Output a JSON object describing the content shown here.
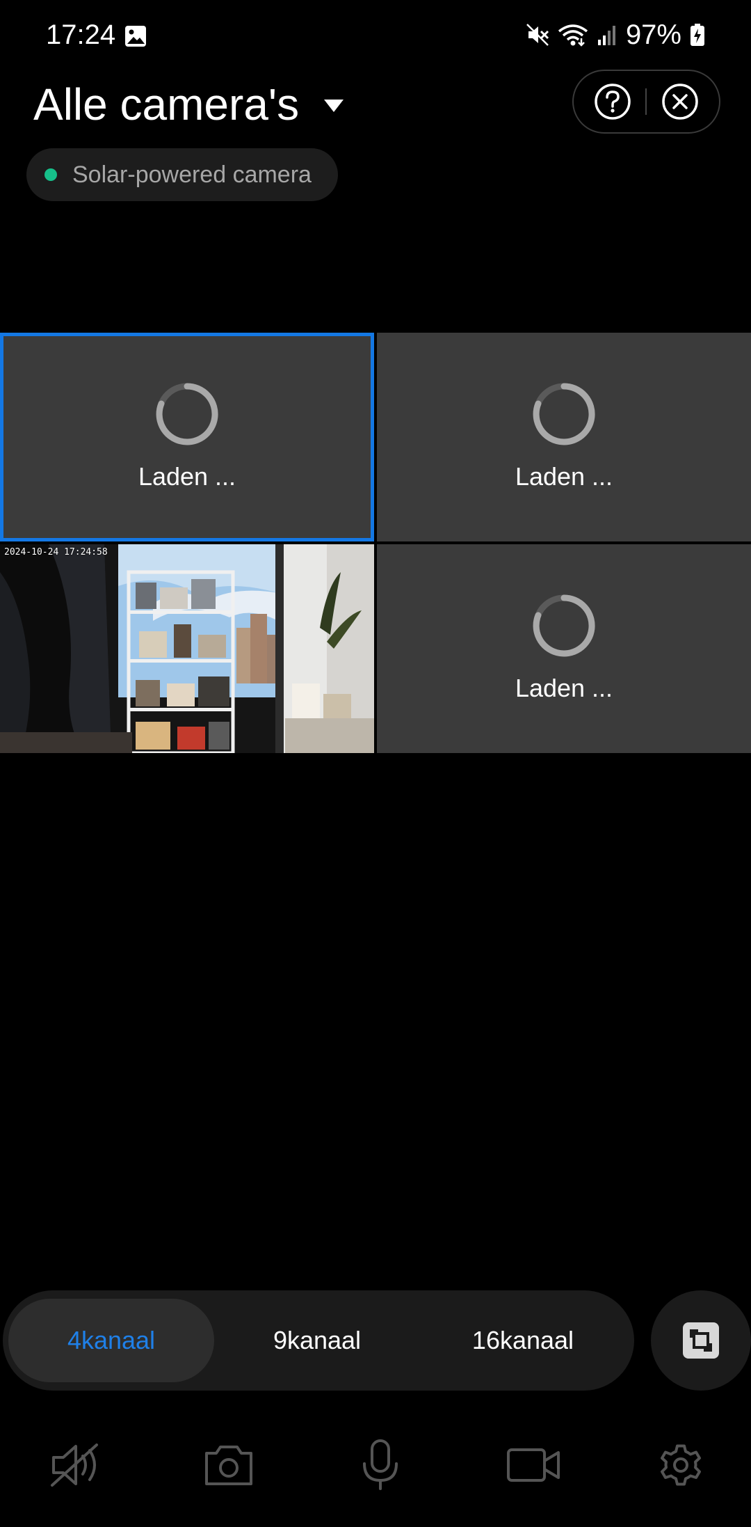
{
  "status_bar": {
    "time": "17:24",
    "battery": "97%",
    "icons": [
      "gallery-icon",
      "mute-icon",
      "wifi-icon",
      "signal-icon",
      "battery-charging-icon"
    ]
  },
  "header": {
    "title": "Alle camera's",
    "dropdown_icon": "triangle-down-icon",
    "help_icon": "help-circle-icon",
    "close_icon": "close-circle-icon"
  },
  "camera_chip": {
    "label": "Solar-powered camera",
    "status_color": "#16c08a"
  },
  "grid": {
    "tiles": [
      {
        "state": "loading",
        "label": "Laden ...",
        "selected": true
      },
      {
        "state": "loading",
        "label": "Laden ..."
      },
      {
        "state": "live",
        "timestamp": "2024-10-24 17:24:58"
      },
      {
        "state": "loading",
        "label": "Laden ..."
      }
    ],
    "selected_color": "#1478e4"
  },
  "channels": {
    "tabs": [
      "4kanaal",
      "9kanaal",
      "16kanaal"
    ],
    "active": "4kanaal",
    "active_color": "#1f80e8",
    "fullscreen_icon": "fullscreen-icon"
  },
  "toolbar": {
    "icons": [
      "speaker-muted-icon",
      "camera-icon",
      "microphone-icon",
      "video-record-icon",
      "settings-gear-icon"
    ]
  }
}
